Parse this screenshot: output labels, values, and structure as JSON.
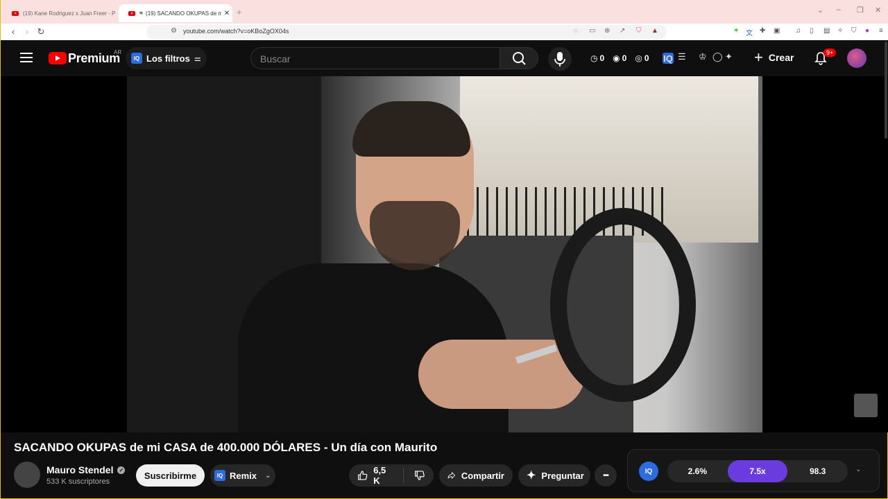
{
  "browser": {
    "tabs": [
      {
        "title": "(19) Kane Rodriguez x Juan Freer - P",
        "active": false
      },
      {
        "title": "(19) SACANDO OKUPAS de m",
        "active": true
      }
    ],
    "new_tab_label": "+",
    "url": "youtube.com/watch?v=oKBoZgOX04s",
    "window_controls": {
      "minimize": "–",
      "restore": "❐",
      "close": "✕"
    }
  },
  "masthead": {
    "logo_text": "Premium",
    "region": "AR",
    "filters_label": "Los filtros",
    "iq_badge": "IQ",
    "search_placeholder": "Buscar",
    "stats": [
      "0",
      "0",
      "0"
    ],
    "create_label": "Crear",
    "notif_count": "9+"
  },
  "video": {
    "title": "SACANDO OKUPAS de mi CASA de 400.000 DÓLARES - Un día con Maurito"
  },
  "channel": {
    "name": "Mauro Stendel",
    "subscribers": "533 K suscriptores",
    "verified_mark": "✓"
  },
  "actions": {
    "subscribe_label": "Suscribirme",
    "remix_label": "Remix",
    "like_count": "6,5 K",
    "share_label": "Compartir",
    "ask_label": "Preguntar",
    "more_label": "•••"
  },
  "iq_panel": {
    "logo": "IQ",
    "metrics": [
      "2.6%",
      "7.5x",
      "98.3"
    ]
  },
  "colors": {
    "accent_red": "#ff0000",
    "iq_blue": "#2d6be0",
    "metric_highlight": "#6a3ce0"
  }
}
